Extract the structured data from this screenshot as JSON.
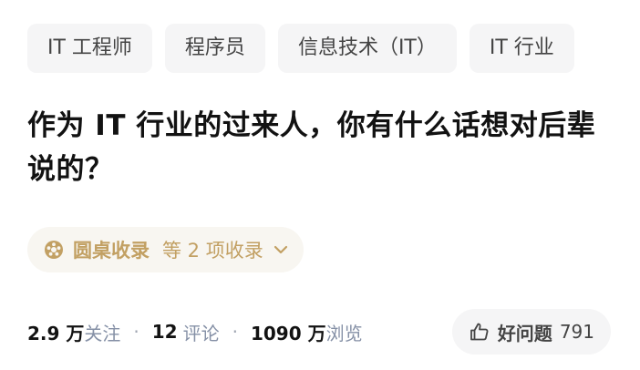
{
  "tags": [
    {
      "label": "IT 工程师"
    },
    {
      "label": "程序员"
    },
    {
      "label": "信息技术（IT）"
    },
    {
      "label": "IT 行业"
    }
  ],
  "question": {
    "title": "作为 IT 行业的过来人，你有什么话想对后辈说的？"
  },
  "collection": {
    "icon": "roundtable-icon",
    "name": "圆桌收录",
    "more": "等 2 项收录",
    "expand_icon": "chevron-down-icon"
  },
  "stats": {
    "followers_value": "2.9 万",
    "followers_label": "关注",
    "separator": "·",
    "comments_value": "12",
    "comments_label": "评论",
    "views_value": "1090 万",
    "views_label": "浏览"
  },
  "good_question": {
    "icon": "thumbs-up-icon",
    "label": "好问题",
    "count": "791"
  },
  "colors": {
    "accent_gold": "#c2a063",
    "chip_bg": "#f5f5f6",
    "title_text": "#121212",
    "muted_text": "#8590a6"
  }
}
